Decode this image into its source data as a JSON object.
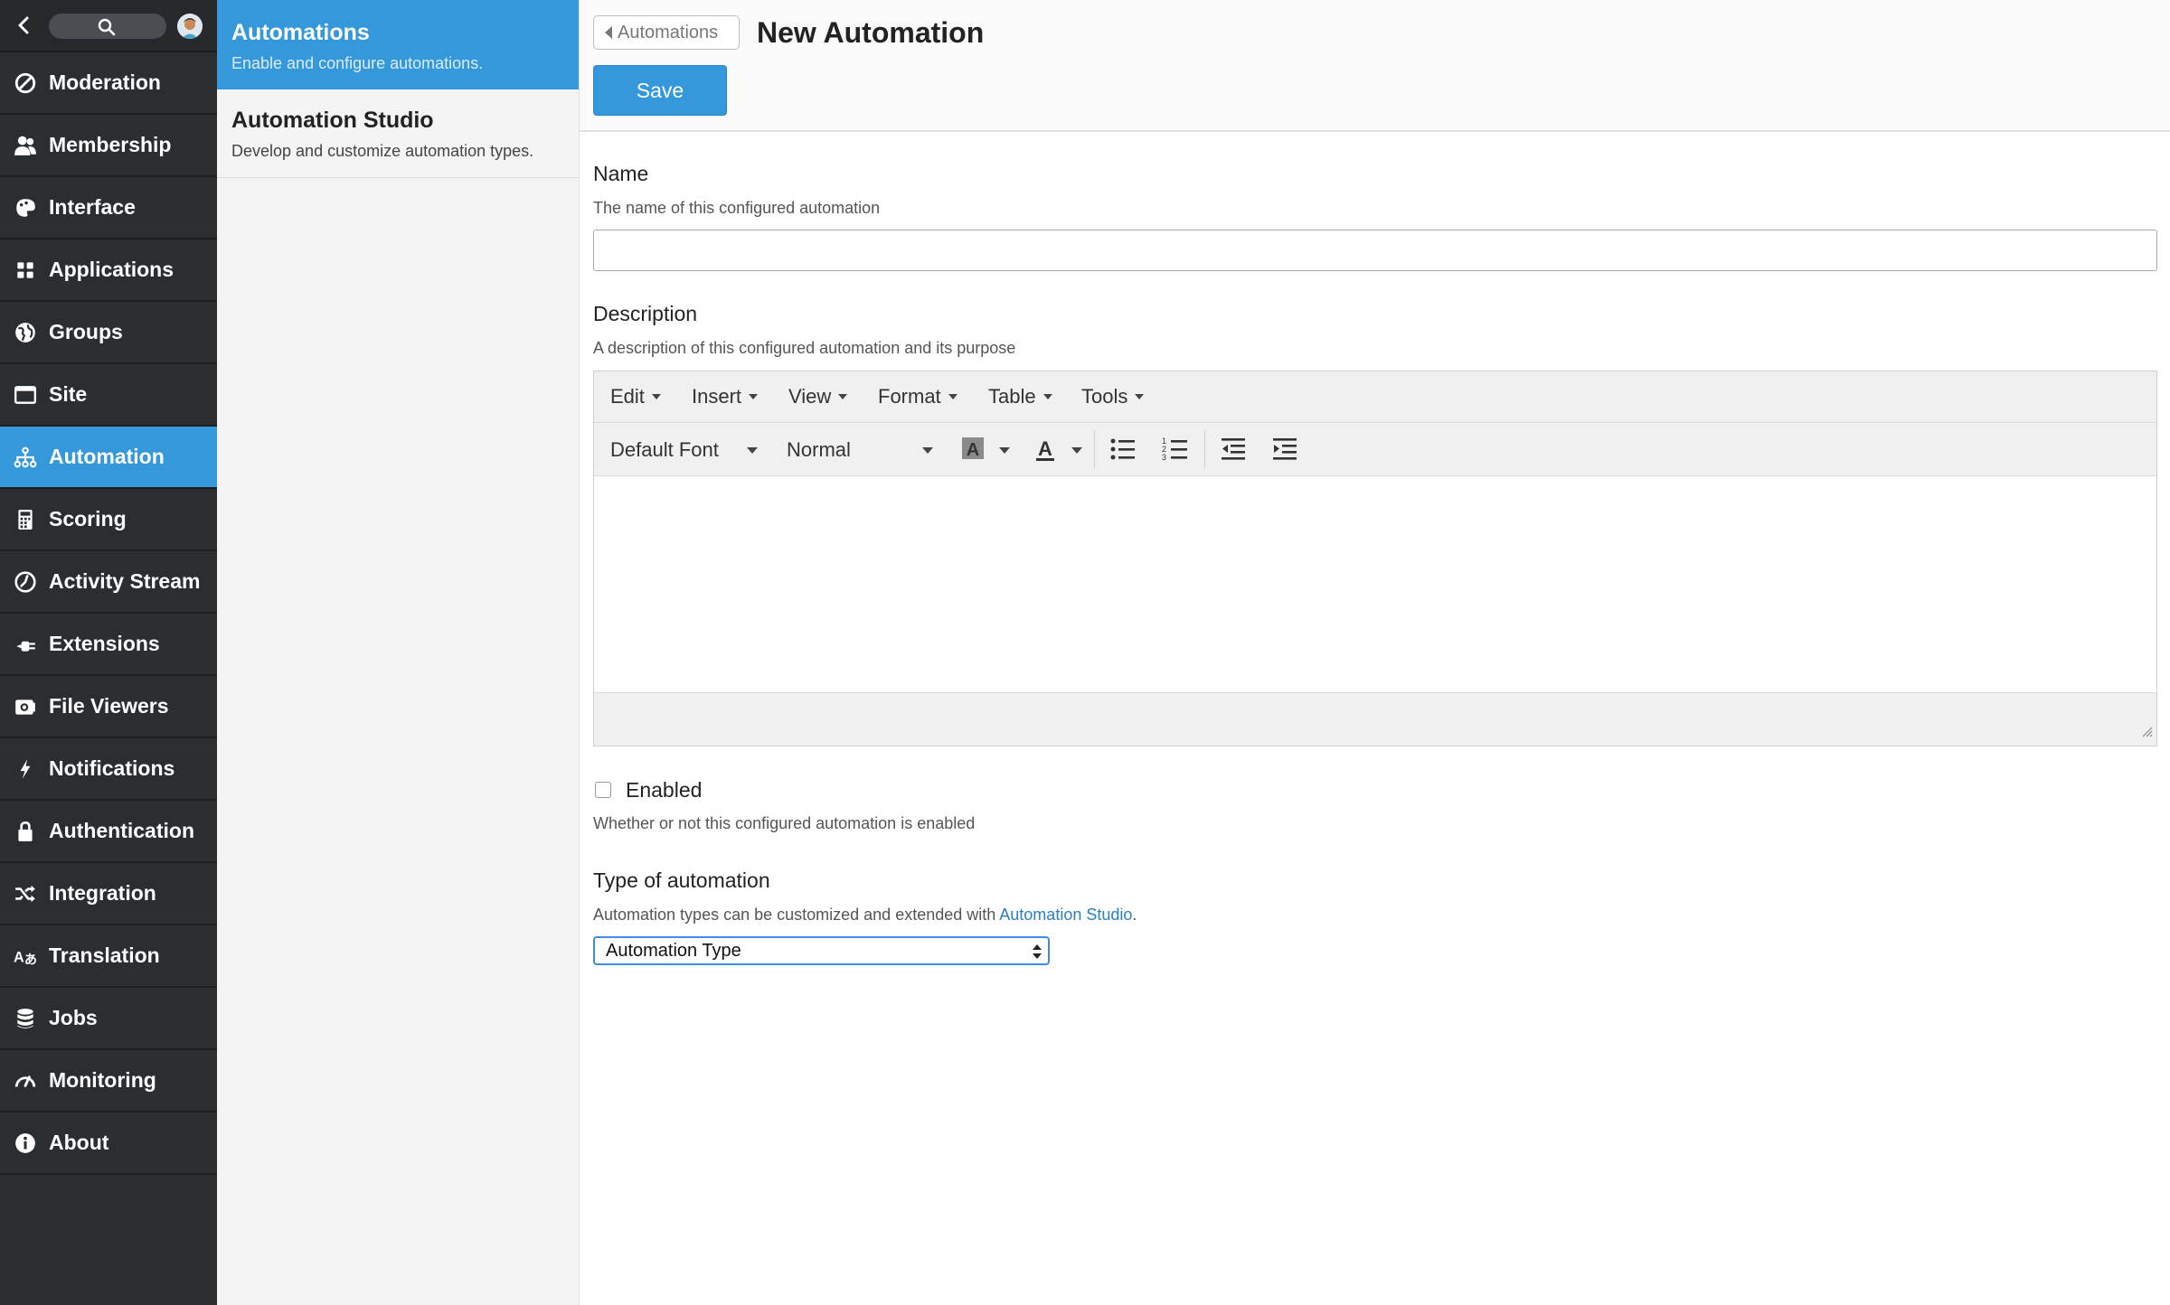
{
  "nav": {
    "items": [
      {
        "label": "Moderation",
        "icon": "ban-icon",
        "active": false
      },
      {
        "label": "Membership",
        "icon": "users-icon",
        "active": false
      },
      {
        "label": "Interface",
        "icon": "palette-icon",
        "active": false
      },
      {
        "label": "Applications",
        "icon": "grid-icon",
        "active": false
      },
      {
        "label": "Groups",
        "icon": "globe-icon",
        "active": false
      },
      {
        "label": "Site",
        "icon": "window-icon",
        "active": false
      },
      {
        "label": "Automation",
        "icon": "sitemap-icon",
        "active": true
      },
      {
        "label": "Scoring",
        "icon": "calculator-icon",
        "active": false
      },
      {
        "label": "Activity Stream",
        "icon": "clock-icon",
        "active": false
      },
      {
        "label": "Extensions",
        "icon": "plug-icon",
        "active": false
      },
      {
        "label": "File Viewers",
        "icon": "camera-icon",
        "active": false
      },
      {
        "label": "Notifications",
        "icon": "bolt-icon",
        "active": false
      },
      {
        "label": "Authentication",
        "icon": "lock-icon",
        "active": false
      },
      {
        "label": "Integration",
        "icon": "shuffle-icon",
        "active": false
      },
      {
        "label": "Translation",
        "icon": "translate-icon",
        "active": false
      },
      {
        "label": "Jobs",
        "icon": "database-icon",
        "active": false
      },
      {
        "label": "Monitoring",
        "icon": "gauge-icon",
        "active": false
      },
      {
        "label": "About",
        "icon": "info-icon",
        "active": false
      }
    ],
    "accent_color": "#3498db",
    "background_color": "#2b2e31"
  },
  "subnav": {
    "items": [
      {
        "title": "Automations",
        "description": "Enable and configure automations.",
        "active": true
      },
      {
        "title": "Automation Studio",
        "description": "Develop and customize automation types.",
        "active": false
      }
    ]
  },
  "header": {
    "breadcrumb": "Automations",
    "title": "New Automation",
    "save_label": "Save"
  },
  "form": {
    "name": {
      "label": "Name",
      "help": "The name of this configured automation",
      "value": ""
    },
    "description": {
      "label": "Description",
      "help": "A description of this configured automation and its purpose"
    },
    "editor": {
      "menus": [
        "Edit",
        "Insert",
        "View",
        "Format",
        "Table",
        "Tools"
      ],
      "font": "Default Font",
      "block_format": "Normal"
    },
    "enabled": {
      "label": "Enabled",
      "help": "Whether or not this configured automation is enabled",
      "checked": false
    },
    "type": {
      "label": "Type of automation",
      "help_prefix": "Automation types can be customized and extended with ",
      "help_link": "Automation Studio",
      "help_suffix": ".",
      "selected": "Automation Type"
    }
  }
}
